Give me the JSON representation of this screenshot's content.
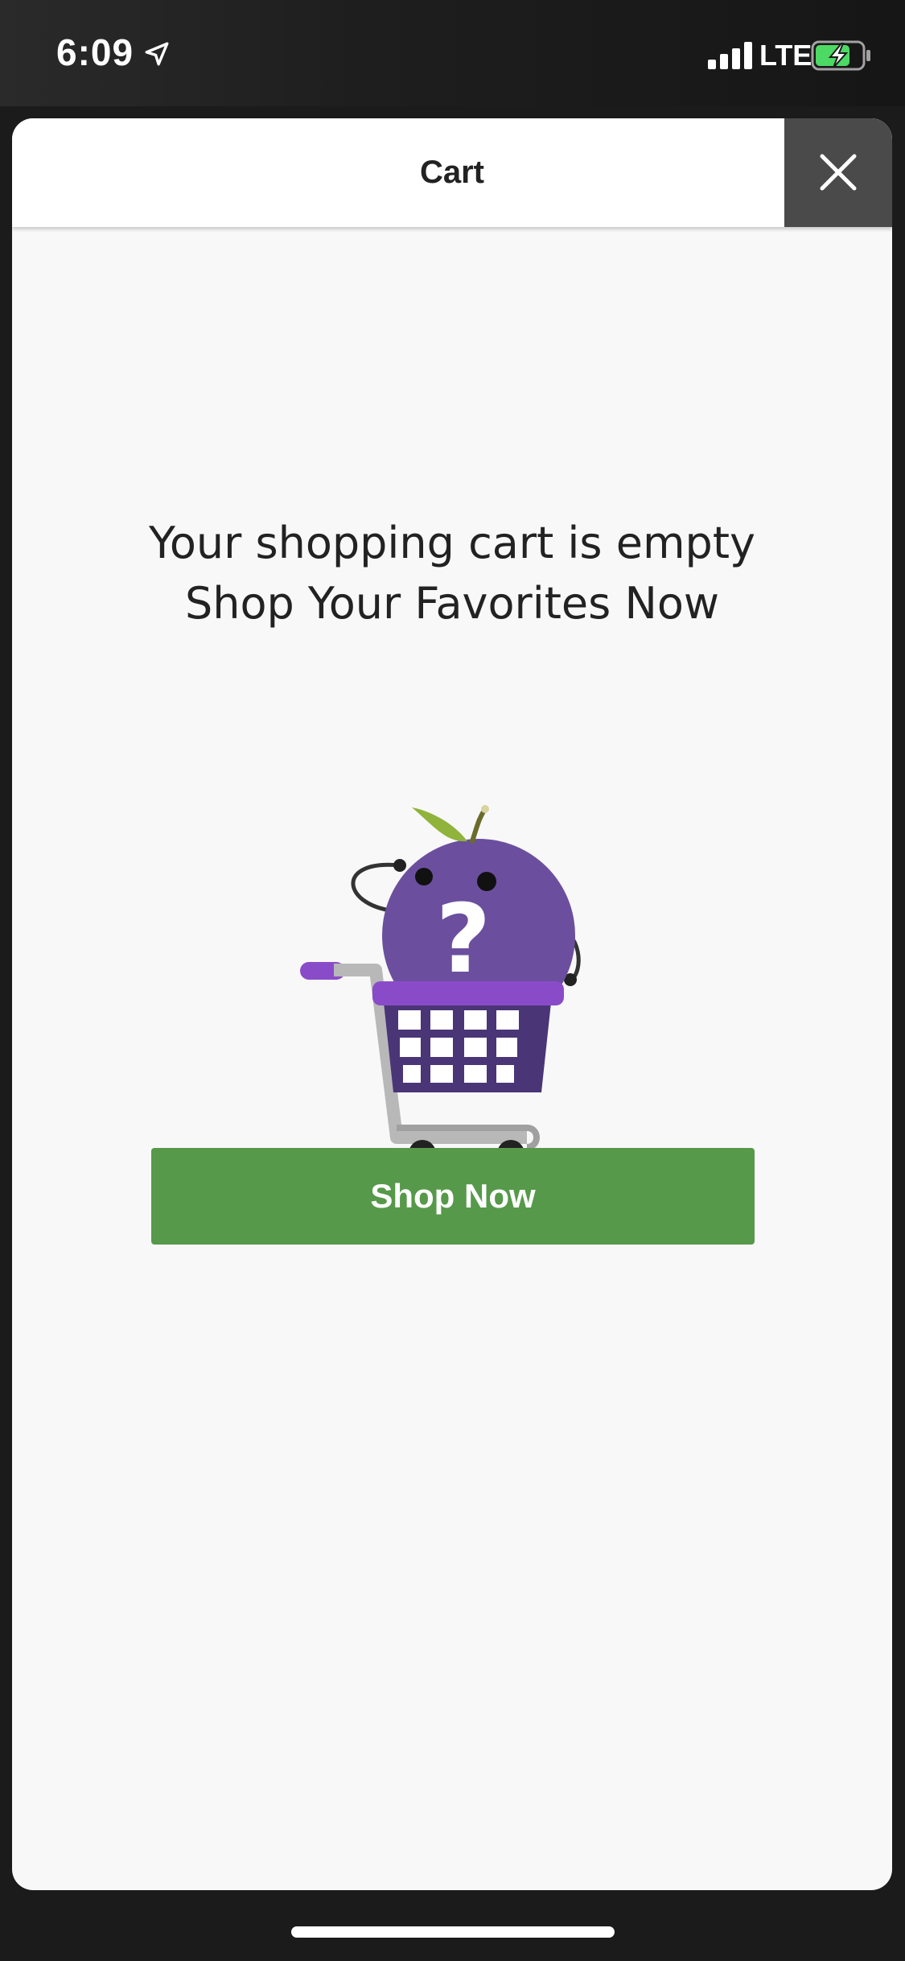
{
  "status_bar": {
    "time": "6:09",
    "network": "LTE",
    "icons": [
      "location-arrow-icon",
      "signal-bars-icon",
      "battery-charging-icon"
    ],
    "battery_color": "#4cd964"
  },
  "header": {
    "title": "Cart",
    "close_icon": "close-icon"
  },
  "empty_state": {
    "line1": "Your shopping cart is empty",
    "line2": "Shop Your Favorites Now",
    "illustration": "confused-plum-in-shopping-cart-illustration"
  },
  "actions": {
    "shop_now_label": "Shop Now"
  },
  "colors": {
    "accent_green": "#56994a",
    "plum_purple": "#6b4f9e",
    "close_bg": "#4a4a4a"
  }
}
